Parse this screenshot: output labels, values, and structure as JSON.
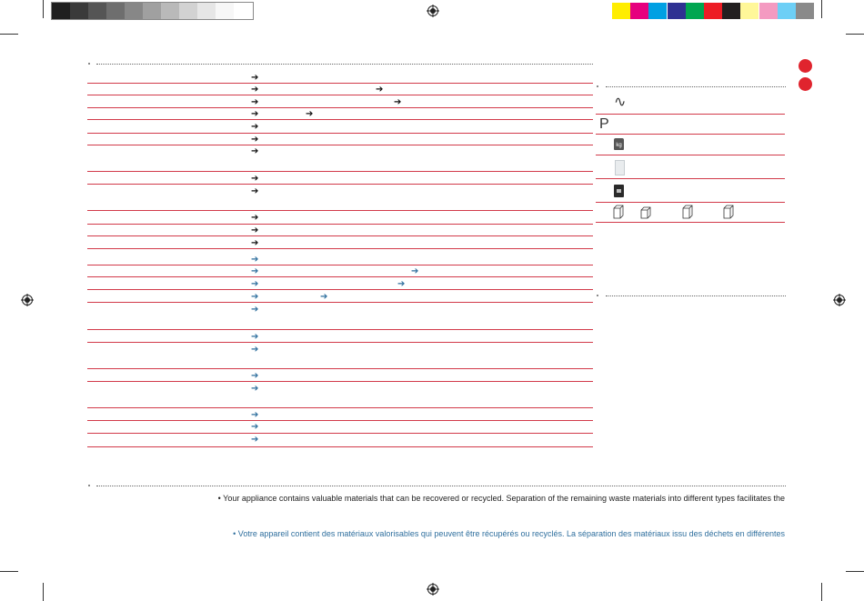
{
  "color_bar": {
    "grayscale": [
      "#1f1f1f",
      "#3a3a3a",
      "#555555",
      "#6e6e6e",
      "#878787",
      "#a0a0a0",
      "#b9b9b9",
      "#d2d2d2",
      "#e6e6e6",
      "#f7f7f7"
    ],
    "process": [
      "#ffed00",
      "#e6007e",
      "#00a0e3",
      "#2e3192",
      "#00a650",
      "#ed1c24",
      "#231f20",
      "#fff799",
      "#f49ac1",
      "#6dcff6",
      "#8a8a8a"
    ]
  },
  "colors": {
    "rule": "#d23a4a",
    "red_marker": "#e0242e",
    "blue_text": "#2f6f9e",
    "black_text": "#111111"
  },
  "table": {
    "arrows_col1": [
      {
        "color": "black"
      },
      {
        "color": "black"
      },
      {
        "color": "black"
      },
      {
        "color": "black"
      },
      {
        "color": "black"
      },
      {
        "color": "black"
      },
      {
        "color": "black"
      },
      {
        "color": "black"
      },
      {
        "color": "black"
      },
      {
        "color": "black"
      },
      {
        "color": "black"
      },
      {
        "color": "black"
      },
      {
        "color": "blue"
      },
      {
        "color": "blue"
      },
      {
        "color": "blue"
      },
      {
        "color": "blue"
      },
      {
        "color": "blue"
      },
      {
        "color": "blue"
      },
      {
        "color": "blue"
      },
      {
        "color": "blue"
      },
      {
        "color": "blue"
      },
      {
        "color": "blue"
      },
      {
        "color": "blue"
      },
      {
        "color": "blue"
      }
    ],
    "arrow_glyph": "➔"
  },
  "spec_icons": [
    "sine-wave-icon",
    "power-p-icon",
    "weight-kg-icon",
    "appliance-white-icon",
    "appliance-black-icon",
    "dimension-box-icon"
  ],
  "spec_symbols": {
    "sine": "∿",
    "power": "P",
    "kg": "kg"
  },
  "footnotes": {
    "en": "• Your appliance contains valuable materials that can be recovered or recycled. Separation of the remaining waste materials into different types facilitates the",
    "fr": "• Votre appareil contient des matériaux valorisables qui peuvent être récupérés ou recyclés. La séparation des matériaux issu des déchets en différentes"
  }
}
